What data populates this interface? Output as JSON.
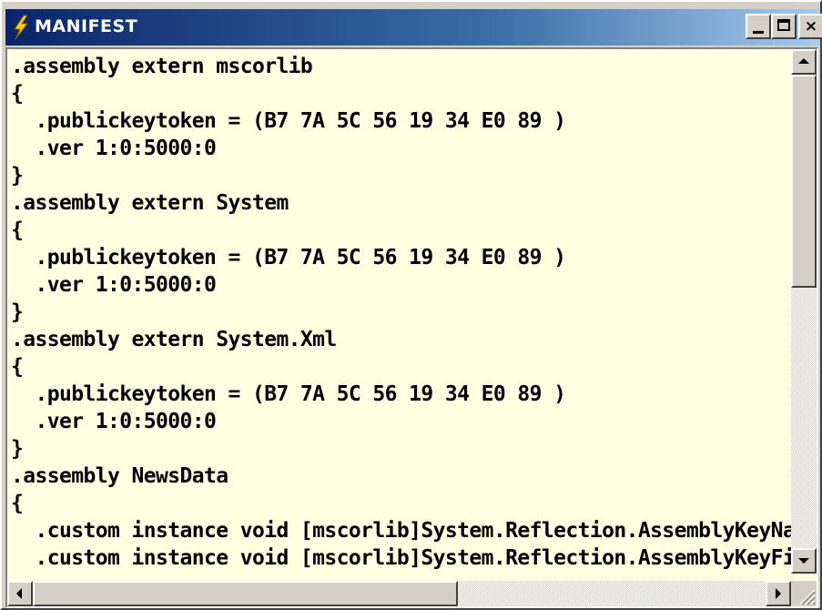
{
  "window": {
    "title": "MANIFEST",
    "icon": "lightning-bolt-icon",
    "controls": {
      "minimize": "minimize-icon",
      "maximize": "maximize-icon",
      "close": "×"
    }
  },
  "editor": {
    "background": "#ffffe1",
    "lines": [
      ".assembly extern mscorlib",
      "{",
      "  .publickeytoken = (B7 7A 5C 56 19 34 E0 89 )",
      "  .ver 1:0:5000:0",
      "}",
      ".assembly extern System",
      "{",
      "  .publickeytoken = (B7 7A 5C 56 19 34 E0 89 )",
      "  .ver 1:0:5000:0",
      "}",
      ".assembly extern System.Xml",
      "{",
      "  .publickeytoken = (B7 7A 5C 56 19 34 E0 89 )",
      "  .ver 1:0:5000:0",
      "}",
      ".assembly NewsData",
      "{",
      "  .custom instance void [mscorlib]System.Reflection.AssemblyKeyName",
      "  .custom instance void [mscorlib]System.Reflection.AssemblyKeyFile"
    ]
  },
  "scrollbars": {
    "vertical": {
      "position": 0.0,
      "visible_fraction": 0.45
    },
    "horizontal": {
      "position": 0.0,
      "visible_fraction": 0.58
    }
  }
}
